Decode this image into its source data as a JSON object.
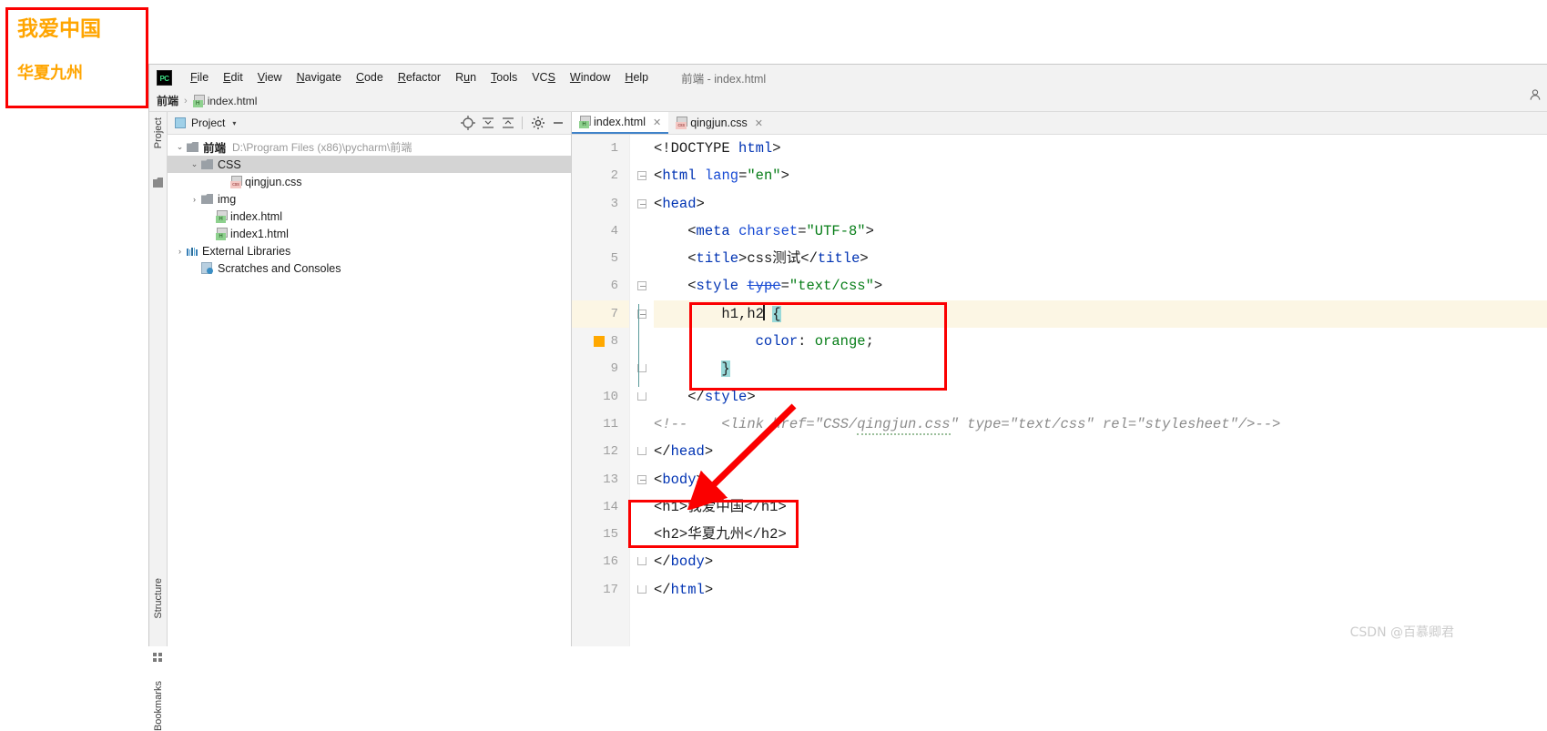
{
  "preview_overlay": {
    "h1_text": "我爱中国",
    "h2_text": "华夏九州",
    "text_color": "#ffa500",
    "border_color": "#fb0000"
  },
  "menu_bar": {
    "app_logo": "PC",
    "items": [
      {
        "label": "File",
        "mnemonic": "F"
      },
      {
        "label": "Edit",
        "mnemonic": "E"
      },
      {
        "label": "View",
        "mnemonic": "V"
      },
      {
        "label": "Navigate",
        "mnemonic": "N"
      },
      {
        "label": "Code",
        "mnemonic": "C"
      },
      {
        "label": "Refactor",
        "mnemonic": "R"
      },
      {
        "label": "Run",
        "mnemonic": "u"
      },
      {
        "label": "Tools",
        "mnemonic": "T"
      },
      {
        "label": "VCS",
        "mnemonic": "S"
      },
      {
        "label": "Window",
        "mnemonic": "W"
      },
      {
        "label": "Help",
        "mnemonic": "H"
      }
    ],
    "window_title": "前端 - index.html"
  },
  "breadcrumb": {
    "project": "前端",
    "separator": "›",
    "file": "index.html"
  },
  "tool_strip": {
    "project_label": "Project",
    "structure_label": "Structure",
    "bookmarks_label": "Bookmarks"
  },
  "project_panel": {
    "title": "Project",
    "caret": "▾",
    "buttons": [
      {
        "name": "locate-icon",
        "glyph": "⊕"
      },
      {
        "name": "expand-all-icon",
        "glyph": "⇲"
      },
      {
        "name": "collapse-all-icon",
        "glyph": "⇱"
      },
      {
        "name": "settings-icon",
        "glyph": "⚙"
      },
      {
        "name": "hide-icon",
        "glyph": "—"
      }
    ],
    "tree": [
      {
        "label": "前端",
        "path": "D:\\Program Files (x86)\\pycharm\\前端",
        "indent": 0,
        "twisty": "⌄",
        "icon": "folder",
        "bold": true,
        "selected": false
      },
      {
        "label": "CSS",
        "path": "",
        "indent": 1,
        "twisty": "⌄",
        "icon": "folder",
        "bold": false,
        "selected": true
      },
      {
        "label": "qingjun.css",
        "path": "",
        "indent": 3,
        "twisty": "",
        "icon": "css",
        "bold": false,
        "selected": false
      },
      {
        "label": "img",
        "path": "",
        "indent": 1,
        "twisty": "›",
        "icon": "folder",
        "bold": false,
        "selected": false
      },
      {
        "label": "index.html",
        "path": "",
        "indent": 2,
        "twisty": "",
        "icon": "html",
        "bold": false,
        "selected": false
      },
      {
        "label": "index1.html",
        "path": "",
        "indent": 2,
        "twisty": "",
        "icon": "html",
        "bold": false,
        "selected": false
      },
      {
        "label": "External Libraries",
        "path": "",
        "indent": 0,
        "twisty": "›",
        "icon": "library",
        "bold": false,
        "selected": false
      },
      {
        "label": "Scratches and Consoles",
        "path": "",
        "indent": 1,
        "twisty": "",
        "icon": "scratch",
        "bold": false,
        "selected": false
      }
    ]
  },
  "editor": {
    "tabs": [
      {
        "label": "index.html",
        "icon": "html",
        "active": true,
        "close": "✕"
      },
      {
        "label": "qingjun.css",
        "icon": "css",
        "active": false,
        "close": "✕"
      }
    ],
    "current_line": 7,
    "color_swatch_line": 8,
    "color_swatch_value": "#ffa800",
    "line_numbers": [
      "1",
      "2",
      "3",
      "4",
      "5",
      "6",
      "7",
      "8",
      "9",
      "10",
      "11",
      "12",
      "13",
      "14",
      "15",
      "16",
      "17"
    ],
    "code_lines": [
      {
        "n": 1,
        "text": "<!DOCTYPE html>"
      },
      {
        "n": 2,
        "text": "<html lang=\"en\">"
      },
      {
        "n": 3,
        "text": "<head>"
      },
      {
        "n": 4,
        "text": "    <meta charset=\"UTF-8\">"
      },
      {
        "n": 5,
        "text": "    <title>css测试</title>"
      },
      {
        "n": 6,
        "text": "    <style type=\"text/css\">"
      },
      {
        "n": 7,
        "text": "        h1,h2 {"
      },
      {
        "n": 8,
        "text": "            color: orange;"
      },
      {
        "n": 9,
        "text": "        }"
      },
      {
        "n": 10,
        "text": "    </style>"
      },
      {
        "n": 11,
        "text": "<!--    <link href=\"CSS/qingjun.css\" type=\"text/css\" rel=\"stylesheet\"/>-->"
      },
      {
        "n": 12,
        "text": "</head>"
      },
      {
        "n": 13,
        "text": "<body>"
      },
      {
        "n": 14,
        "text": "<h1>我爱中国</h1>"
      },
      {
        "n": 15,
        "text": "<h2>华夏九州</h2>"
      },
      {
        "n": 16,
        "text": "</body>"
      },
      {
        "n": 17,
        "text": "</html>"
      }
    ]
  },
  "annotations": {
    "css_rule_box_color": "#fb0000",
    "tags_box_color": "#fb0000",
    "arrow_color": "#fb0000"
  },
  "watermark": "CSDN @百慕卿君"
}
